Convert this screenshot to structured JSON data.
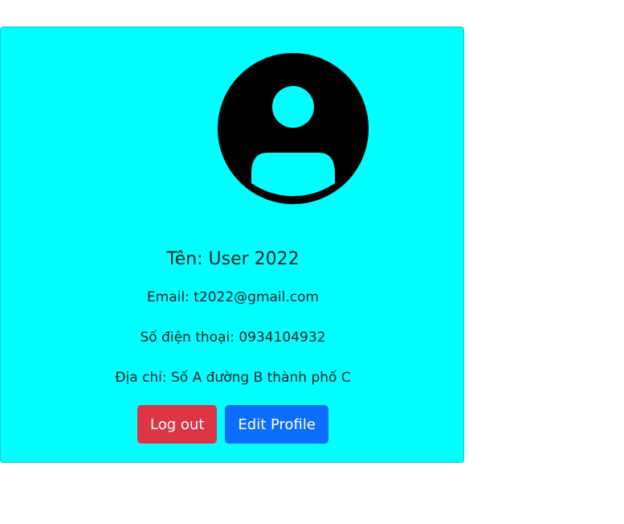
{
  "profile": {
    "avatar_icon": "person-circle-icon",
    "name": "Tên: User 2022",
    "email": "Email: t2022@gmail.com",
    "phone": "Số điện thoại: 0934104932",
    "address": "Địa chỉ: Số A đường B thành phố C"
  },
  "actions": {
    "logout_label": "Log out",
    "edit_label": "Edit Profile"
  },
  "colors": {
    "card_background": "#00ffff",
    "logout_button": "#dc3545",
    "edit_button": "#0d6efd"
  }
}
